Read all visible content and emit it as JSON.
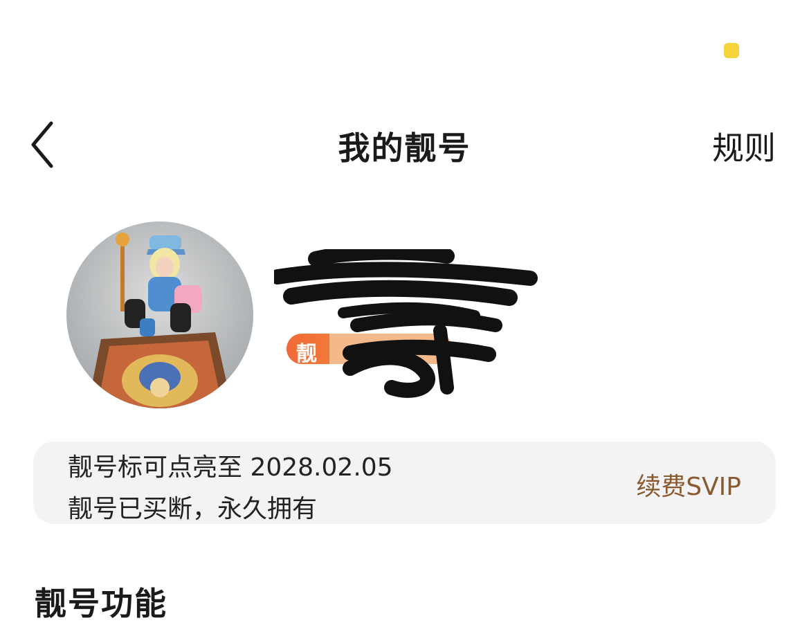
{
  "status_bar": {
    "indicator_color": "#f5d33a"
  },
  "nav": {
    "back_icon": "chevron-left-icon",
    "title": "我的靓号",
    "rules_label": "规则"
  },
  "profile": {
    "avatar_icon": "avatar-photo",
    "name_redacted": true,
    "badge": {
      "label": "靓",
      "number_redacted": true,
      "gradient_start": "#f06a35",
      "gradient_end": "#f7a04a"
    }
  },
  "info_card": {
    "line1": "靓号标可点亮至 2028.02.05",
    "line2": "靓号已买断，永久拥有",
    "renew_label": "续费SVIP",
    "renew_color": "#8a5a2e"
  },
  "section": {
    "title": "靓号功能"
  }
}
